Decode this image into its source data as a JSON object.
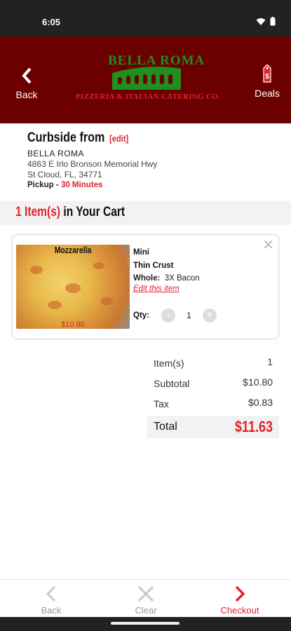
{
  "status": {
    "time": "6:05"
  },
  "appbar": {
    "back_label": "Back",
    "deals_label": "Deals",
    "brand_title": "BELLA ROMA",
    "brand_sub": "PIZZERIA & ITALIAN CATERING CO."
  },
  "store": {
    "heading": "Curbside from",
    "edit": "[edit]",
    "name": "BELLA ROMA",
    "address1": "4863 E Irlo Bronson Memorial Hwy",
    "address2": "St Cloud, FL, 34771",
    "pickup_label": "Pickup - ",
    "pickup_time": "30 Minutes"
  },
  "cart": {
    "count": "1 Item(s)",
    "suffix": " in Your Cart"
  },
  "item": {
    "image_label": "Mozzarella",
    "image_price": "$10.80",
    "size": "Mini",
    "crust": "Thin Crust",
    "whole_label": "Whole:",
    "whole_value": "3X Bacon",
    "edit_link": "Edit this item",
    "qty_label": "Qty:",
    "qty_value": "1",
    "minus": "-",
    "plus": "+"
  },
  "totals": {
    "items_label": "Item(s)",
    "items_value": "1",
    "subtotal_label": "Subtotal",
    "subtotal_value": "$10.80",
    "tax_label": "Tax",
    "tax_value": "$0.83",
    "total_label": "Total",
    "total_value": "$11.63"
  },
  "bottomnav": {
    "back": "Back",
    "clear": "Clear",
    "checkout": "Checkout"
  },
  "colors": {
    "brand_red": "#e0242a",
    "appbar_bg": "#6b0000",
    "logo_green": "#1f8f1f"
  }
}
